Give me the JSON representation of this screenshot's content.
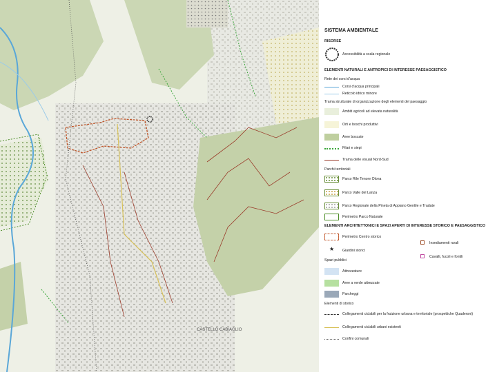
{
  "map": {
    "place_label": "CASTELLO\nCABIAGLIO"
  },
  "legend": {
    "title": "SISTEMA AMBIENTALE",
    "risorse": {
      "heading": "RISORSE",
      "items": [
        {
          "label": "Accessibilità a scala regionale",
          "symbol": "circle-dotted-ring",
          "color": "#333333"
        }
      ]
    },
    "naturali": {
      "heading": "ELEMENTI NATURALI E ANTROPICI DI INTERESSE PAESAGGISTICO",
      "acque_heading": "Rete dei corsi d'acqua",
      "acque": [
        {
          "label": "Corsi d'acqua principali",
          "color": "#5aa7d8"
        },
        {
          "label": "Reticolo idrico minore",
          "color": "#9ccbe8"
        }
      ],
      "trame_heading": "Trama strutturale di organizzazione degli elementi del paesaggio",
      "trame": [
        {
          "label": "Ambiti agricoli ad elevata naturalità",
          "color": "#e9efdc"
        },
        {
          "label": "Orti e boschi produttivi",
          "color": "#f6f4d8"
        },
        {
          "label": "Aree boscate",
          "color": "#bfcf9f"
        },
        {
          "label": "Filari e siepi",
          "color": "#3aa63a"
        },
        {
          "label": "Trama delle visuali Nord-Sud",
          "color": "#9a3b2a"
        }
      ]
    },
    "parchi": {
      "heading": "Parchi territoriali",
      "items": [
        {
          "label": "Parco Rile Tenore Olona",
          "border": "#6a8f3a",
          "dots": "#6a8f3a"
        },
        {
          "label": "Parco Valle del Lanza",
          "border": "#6a8f3a",
          "dots": "#caa64a"
        },
        {
          "label": "Parco Regionale della Pineta di Appiano Gentile e Tradate",
          "border": "#6a8f3a",
          "dots": "#888888"
        },
        {
          "label": "Perimetro Parco Naturale",
          "border": "#4f8f2a",
          "dots": ""
        }
      ]
    },
    "architettonici": {
      "heading": "ELEMENTI ARCHITETTONICI E SPAZI APERTI DI INTERESSE STORICO E PAESAGGISTICO",
      "items": [
        {
          "label": "Perimetro Centro storico",
          "color": "#c0562a"
        },
        {
          "label": "Giardini storici",
          "color": "#222222"
        }
      ],
      "right_items": [
        {
          "label": "Insediamenti rurali",
          "color": "#a0522d"
        },
        {
          "label": "Cavalli, fucoli e fontili",
          "color": "#c04aa0"
        }
      ]
    },
    "spazi": {
      "heading": "Spazi pubblici",
      "items": [
        {
          "label": "Attrezzature",
          "color": "#d3e3f3"
        },
        {
          "label": "Aree a verde attrezzate",
          "color": "#b6e0a0"
        },
        {
          "label": "Parcheggi",
          "color": "#9aa8b8"
        }
      ]
    },
    "storici": {
      "heading": "Elementi di storico",
      "items": [
        {
          "label": "Collegamenti ciclabili per la fruizione urbana e territoriale (prospettiche Quaderoni)",
          "color": "#333333",
          "style": "dashed"
        },
        {
          "label": "Collegamenti ciclabili urbani esistenti",
          "color": "#d8c25a",
          "style": "solid"
        },
        {
          "label": "Confini comunali",
          "color": "#555555",
          "style": "dotted"
        }
      ]
    }
  }
}
